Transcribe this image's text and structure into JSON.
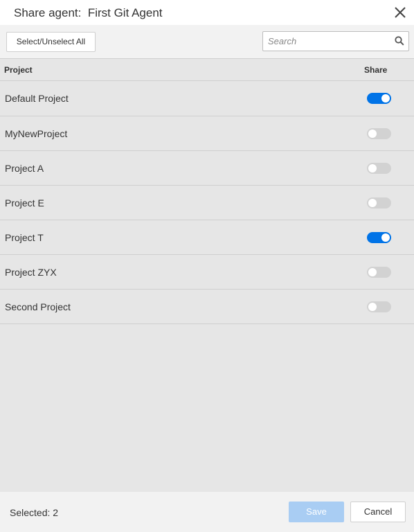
{
  "dialog": {
    "title_prefix": "Share agent:",
    "agent_name": "First Git Agent",
    "close_icon": "close-icon"
  },
  "toolbar": {
    "select_all_label": "Select/Unselect All",
    "search": {
      "placeholder": "Search",
      "value": "",
      "icon": "search-icon"
    }
  },
  "table": {
    "columns": {
      "project": "Project",
      "share": "Share"
    },
    "rows": [
      {
        "label": "Default Project",
        "shared": true
      },
      {
        "label": "MyNewProject",
        "shared": false
      },
      {
        "label": "Project A",
        "shared": false
      },
      {
        "label": "Project E",
        "shared": false
      },
      {
        "label": "Project T",
        "shared": true
      },
      {
        "label": "Project ZYX",
        "shared": false
      },
      {
        "label": "Second Project",
        "shared": false
      }
    ]
  },
  "footer": {
    "selected_text": "Selected: 2",
    "save_label": "Save",
    "cancel_label": "Cancel"
  },
  "colors": {
    "accent": "#0073e7",
    "save_disabled": "#a9cdf3",
    "toggle_off": "#d2d2d2"
  }
}
